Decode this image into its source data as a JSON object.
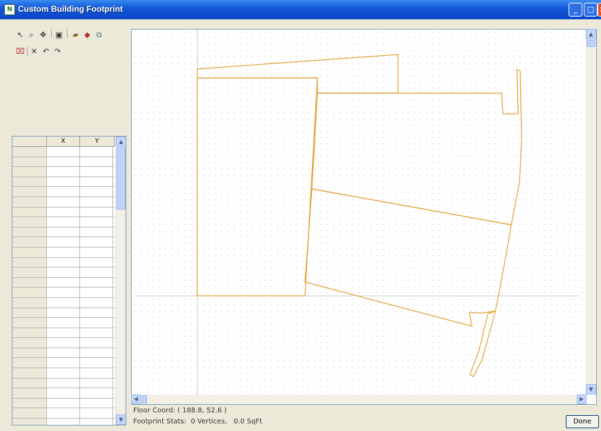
{
  "window": {
    "title": "Custom Building Footprint",
    "app_icon": "N"
  },
  "toolbar": {
    "icons": [
      "select-arrow-icon",
      "zoom-icon",
      "pan-icon",
      "page-icon",
      "open-folder-icon",
      "paint-icon",
      "layers-icon",
      "delete-vertex-icon",
      "delete-icon",
      "undo-icon",
      "redo-icon"
    ]
  },
  "table": {
    "columns": [
      "",
      "X",
      "Y"
    ],
    "rows": [
      [
        "",
        "",
        ""
      ],
      [
        "",
        "",
        ""
      ],
      [
        "",
        "",
        ""
      ],
      [
        "",
        "",
        ""
      ],
      [
        "",
        "",
        ""
      ],
      [
        "",
        "",
        ""
      ],
      [
        "",
        "",
        ""
      ],
      [
        "",
        "",
        ""
      ],
      [
        "",
        "",
        ""
      ],
      [
        "",
        "",
        ""
      ],
      [
        "",
        "",
        ""
      ],
      [
        "",
        "",
        ""
      ],
      [
        "",
        "",
        ""
      ],
      [
        "",
        "",
        ""
      ],
      [
        "",
        "",
        ""
      ],
      [
        "",
        "",
        ""
      ],
      [
        "",
        "",
        ""
      ],
      [
        "",
        "",
        ""
      ],
      [
        "",
        "",
        ""
      ],
      [
        "",
        "",
        ""
      ],
      [
        "",
        "",
        ""
      ],
      [
        "",
        "",
        ""
      ],
      [
        "",
        "",
        ""
      ],
      [
        "",
        "",
        ""
      ],
      [
        "",
        "",
        ""
      ],
      [
        "",
        "",
        ""
      ],
      [
        "",
        "",
        ""
      ],
      [
        "",
        "",
        ""
      ]
    ]
  },
  "status": {
    "floor_coord": "Floor Coord: ( 188.8, 52.6 )",
    "footprint_stats": "Footprint Stats:  0 Vertices,   0.0 SqFt"
  },
  "buttons": {
    "done": "Done"
  },
  "colors": {
    "footprint_line": "#e0a030",
    "axis_line": "#c8c8c8",
    "grid_dot": "#b8b8b8"
  }
}
